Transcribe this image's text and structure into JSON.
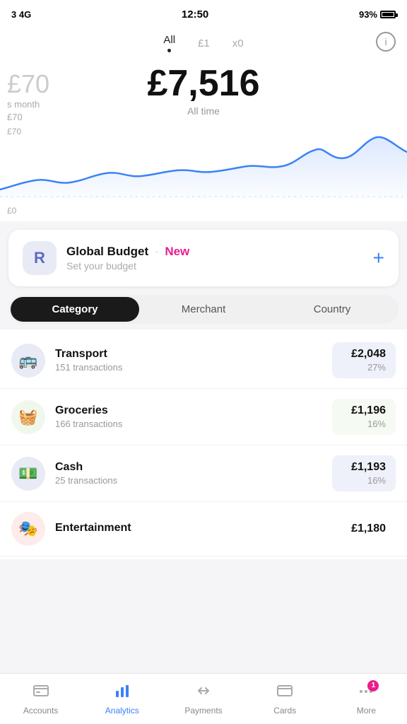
{
  "statusBar": {
    "signal": "3 4G",
    "time": "12:50",
    "battery": "93%"
  },
  "headerTabs": {
    "tabs": [
      {
        "id": "all",
        "label": "All",
        "active": true
      },
      {
        "id": "pound1",
        "label": "£1",
        "active": false
      },
      {
        "id": "x0",
        "label": "x0",
        "active": false
      }
    ],
    "infoButton": "i"
  },
  "amountSection": {
    "sideAmount": "£70",
    "sideLabel": "s month",
    "sideSublabel": "£70",
    "mainValue": "£7,516",
    "mainSubtitle": "All time"
  },
  "chart": {
    "topLabel": "£70",
    "bottomLabel": "£0"
  },
  "budgetCard": {
    "iconLabel": "R",
    "title": "Global Budget",
    "newLabel": "New",
    "subtitle": "Set your budget",
    "plusLabel": "+"
  },
  "segmentControl": {
    "options": [
      {
        "id": "category",
        "label": "Category",
        "active": true
      },
      {
        "id": "merchant",
        "label": "Merchant",
        "active": false
      },
      {
        "id": "country",
        "label": "Country",
        "active": false
      }
    ]
  },
  "categories": [
    {
      "id": "transport",
      "name": "Transport",
      "transactions": "151 transactions",
      "amount": "£2,048",
      "percentage": "27%",
      "iconEmoji": "🚌",
      "iconBg": "transport-bg",
      "amountBg": "transport-pct-bg"
    },
    {
      "id": "groceries",
      "name": "Groceries",
      "transactions": "166 transactions",
      "amount": "£1,196",
      "percentage": "16%",
      "iconEmoji": "🧺",
      "iconBg": "groceries-bg",
      "amountBg": "groceries-pct-bg"
    },
    {
      "id": "cash",
      "name": "Cash",
      "transactions": "25 transactions",
      "amount": "£1,193",
      "percentage": "16%",
      "iconEmoji": "💵",
      "iconBg": "cash-bg",
      "amountBg": "cash-pct-bg"
    },
    {
      "id": "entertainment",
      "name": "Entertainment",
      "transactions": "",
      "amount": "£1,180",
      "percentage": "",
      "iconEmoji": "🎭",
      "iconBg": "entertainment-bg",
      "amountBg": ""
    }
  ],
  "bottomNav": {
    "items": [
      {
        "id": "accounts",
        "label": "Accounts",
        "active": false,
        "icon": "wallet"
      },
      {
        "id": "analytics",
        "label": "Analytics",
        "active": true,
        "icon": "bar-chart"
      },
      {
        "id": "payments",
        "label": "Payments",
        "active": false,
        "icon": "payments"
      },
      {
        "id": "cards",
        "label": "Cards",
        "active": false,
        "icon": "cards"
      },
      {
        "id": "more",
        "label": "More",
        "active": false,
        "icon": "more",
        "badge": "1"
      }
    ]
  }
}
